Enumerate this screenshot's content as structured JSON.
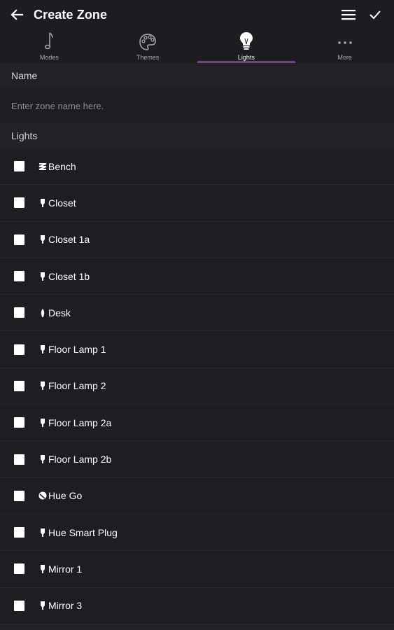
{
  "appbar": {
    "title": "Create Zone",
    "back_icon": "arrow-left-icon",
    "menu_icon": "hamburger-menu-icon",
    "confirm_icon": "checkmark-icon"
  },
  "tabs": [
    {
      "label": "Modes",
      "icon": "music-note-icon",
      "active": false
    },
    {
      "label": "Themes",
      "icon": "palette-icon",
      "active": false
    },
    {
      "label": "Lights",
      "icon": "light-bulb-icon",
      "active": true
    },
    {
      "label": "More",
      "icon": "more-dots-icon",
      "active": false
    }
  ],
  "name_section": {
    "header": "Name",
    "placeholder": "Enter zone name here.",
    "value": ""
  },
  "lights_section": {
    "header": "Lights",
    "items": [
      {
        "label": "Bench",
        "icon": "lightstrip-icon",
        "checked": false
      },
      {
        "label": "Closet",
        "icon": "bulb-icon",
        "checked": false
      },
      {
        "label": "Closet 1a",
        "icon": "bulb-icon",
        "checked": false
      },
      {
        "label": "Closet 1b",
        "icon": "bulb-icon",
        "checked": false
      },
      {
        "label": "Desk",
        "icon": "candle-bulb-icon",
        "checked": false
      },
      {
        "label": "Floor Lamp 1",
        "icon": "bulb-icon",
        "checked": false
      },
      {
        "label": "Floor Lamp 2",
        "icon": "bulb-icon",
        "checked": false
      },
      {
        "label": "Floor Lamp 2a",
        "icon": "bulb-icon",
        "checked": false
      },
      {
        "label": "Floor Lamp 2b",
        "icon": "bulb-icon",
        "checked": false
      },
      {
        "label": "Hue Go",
        "icon": "hue-go-icon",
        "checked": false
      },
      {
        "label": "Hue Smart Plug",
        "icon": "bulb-icon",
        "checked": false
      },
      {
        "label": "Mirror 1",
        "icon": "bulb-icon",
        "checked": false
      },
      {
        "label": "Mirror 3",
        "icon": "bulb-icon",
        "checked": false
      }
    ]
  },
  "colors": {
    "accent": "#7b3a93",
    "background": "#232227",
    "bar": "#1d1c21"
  }
}
